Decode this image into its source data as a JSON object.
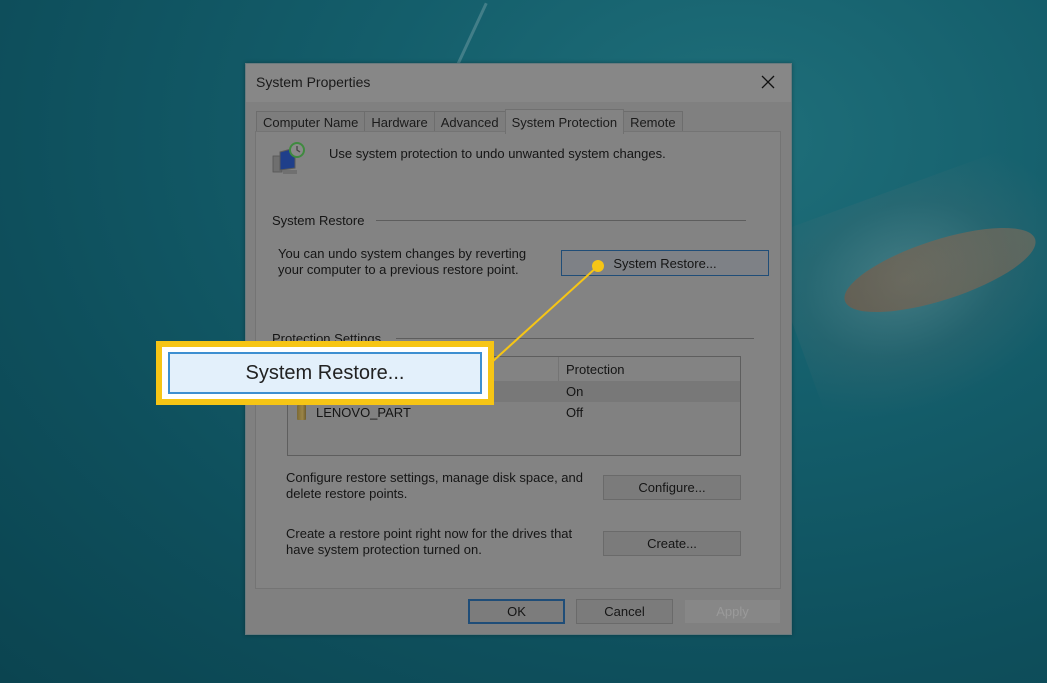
{
  "dialog": {
    "title": "System Properties",
    "close_icon": "close-icon",
    "tabs": [
      {
        "label": "Computer Name",
        "active": false
      },
      {
        "label": "Hardware",
        "active": false
      },
      {
        "label": "Advanced",
        "active": false
      },
      {
        "label": "System Protection",
        "active": true
      },
      {
        "label": "Remote",
        "active": false
      }
    ],
    "intro_text": "Use system protection to undo unwanted system changes.",
    "system_restore": {
      "group_label": "System Restore",
      "description_line1": "You can undo system changes by reverting",
      "description_line2": "your computer to a previous restore point.",
      "button_label": "System Restore..."
    },
    "protection_settings": {
      "group_label": "Protection Settings",
      "columns": [
        "",
        "Protection"
      ],
      "rows": [
        {
          "name": "",
          "protection": "On",
          "selected": true
        },
        {
          "name": "LENOVO_PART",
          "protection": "Off",
          "selected": false
        }
      ]
    },
    "configure": {
      "description_line1": "Configure restore settings, manage disk space, and",
      "description_line2": "delete restore points.",
      "button_label": "Configure..."
    },
    "create": {
      "description_line1": "Create a restore point right now for the drives that",
      "description_line2": "have system protection turned on.",
      "button_label": "Create..."
    },
    "footer": {
      "ok_label": "OK",
      "cancel_label": "Cancel",
      "apply_label": "Apply"
    }
  },
  "callout": {
    "label": "System Restore...",
    "color": "#f6c515"
  }
}
